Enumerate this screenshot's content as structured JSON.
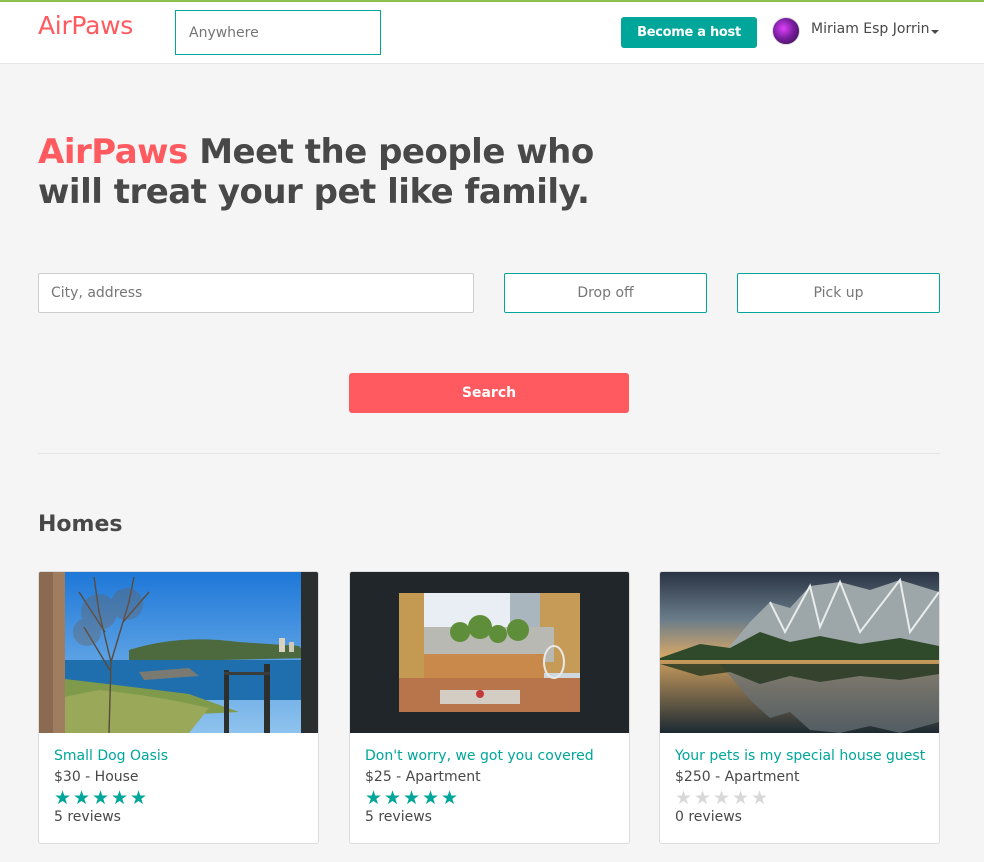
{
  "nav": {
    "logo": "AirPaws",
    "search_placeholder": "Anywhere",
    "host_button": "Become a host",
    "user_name": "Miriam Esp Jorrin"
  },
  "hero": {
    "brand": "AirPaws",
    "tagline": "Meet the people who will treat your pet like family."
  },
  "search": {
    "city_placeholder": "City, address",
    "dropoff_placeholder": "Drop off",
    "pickup_placeholder": "Pick up",
    "button": "Search"
  },
  "homes": {
    "title": "Homes",
    "listings": [
      {
        "title": "Small Dog Oasis",
        "price": "$30 - House",
        "rating": 5,
        "reviews": "5 reviews"
      },
      {
        "title": "Don't worry, we got you covered",
        "price": "$25 - Apartment",
        "rating": 5,
        "reviews": "5 reviews"
      },
      {
        "title": "Your pets is my special house guest",
        "price": "$250 - Apartment",
        "rating": 0,
        "reviews": "0 reviews"
      }
    ]
  },
  "colors": {
    "brand": "#ff5a5f",
    "accent": "#00a699"
  }
}
